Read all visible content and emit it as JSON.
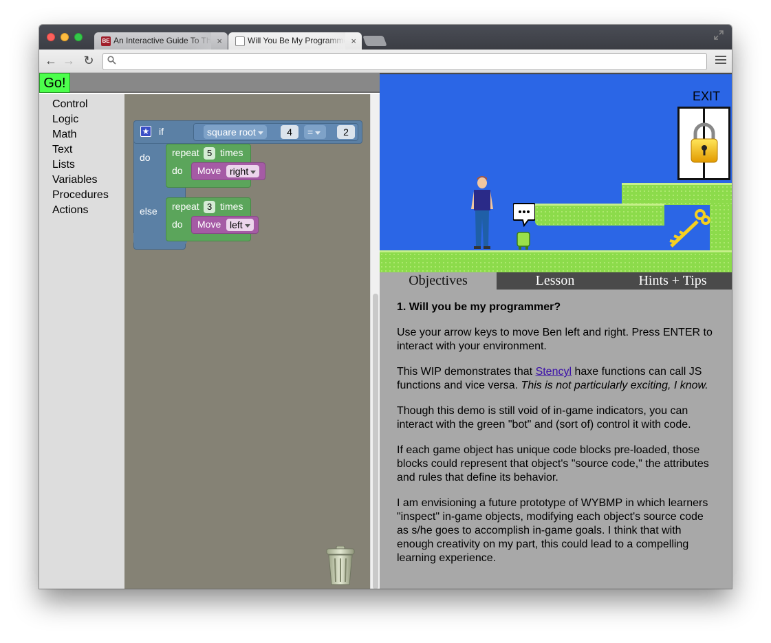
{
  "browser": {
    "tabs": [
      {
        "favicon": "BE",
        "title": "An Interactive Guide To Th",
        "close": "×"
      },
      {
        "favicon": "",
        "title": "Will You Be My Programme",
        "close": "×"
      }
    ],
    "address": {
      "value": "",
      "placeholder": ""
    }
  },
  "app": {
    "go_label": "Go!",
    "toolbox": [
      "Control",
      "Logic",
      "Math",
      "Text",
      "Lists",
      "Variables",
      "Procedures",
      "Actions"
    ],
    "blocks": {
      "if_label": "if",
      "do_label": "do",
      "else_label": "else",
      "sqrt_label": "square root",
      "left_value": "4",
      "compare_op": "=",
      "right_value": "2",
      "repeat_label": "repeat",
      "times_label": "times",
      "repeat_then_count": "5",
      "repeat_else_count": "3",
      "inner_do_label": "do",
      "move_label": "Move",
      "move_then_dir": "right",
      "move_else_dir": "left"
    },
    "game": {
      "exit_label": "EXIT"
    },
    "panel_tabs": [
      "Objectives",
      "Lesson",
      "Hints + Tips"
    ],
    "objectives": {
      "heading": "1. Will you be my programmer?",
      "p1": "Use your arrow keys to move Ben left and right. Press ENTER to interact with your environment.",
      "p2_before": "This WIP demonstrates that ",
      "p2_link": "Stencyl",
      "p2_after": " haxe functions can call JS functions and vice versa. ",
      "p2_italic": "This is not particularly exciting, I know.",
      "p3": "Though this demo is still void of in-game indicators, you can interact with the green \"bot\" and (sort of) control it with code.",
      "p4": "If each game object has unique code blocks pre-loaded, those blocks could represent that object's \"source code,\" the attributes and rules that define its behavior.",
      "p5": "I am envisioning a future prototype of WYBMP in which learners \"inspect\" in-game objects, modifying each object's source code as s/he goes to accomplish in-game goals. I think that with enough creativity on my part, this could lead to a compelling learning experience."
    }
  },
  "colors": {
    "go": "#4cff4c",
    "logic_block": "#5b80a5",
    "loop_block": "#5ba55b",
    "action_block": "#a55ba5",
    "workspace": "#858275",
    "sky": "#2b66e6",
    "grass": "#8cdb4b",
    "link": "#3a0ea8"
  }
}
